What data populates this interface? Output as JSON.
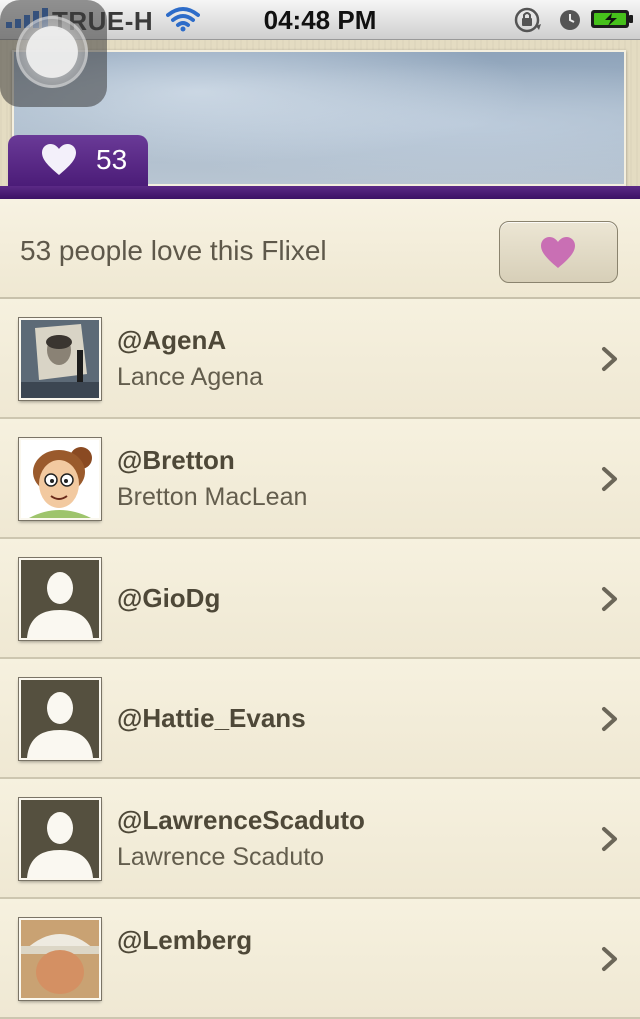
{
  "status_bar": {
    "carrier": "TRUE-H",
    "time": "04:48 PM"
  },
  "photo": {
    "like_count": "53"
  },
  "summary": {
    "text": "53 people love this Flixel"
  },
  "users": [
    {
      "handle": "@AgenA",
      "name": "Lance Agena"
    },
    {
      "handle": "@Bretton",
      "name": "Bretton MacLean"
    },
    {
      "handle": "@GioDg",
      "name": ""
    },
    {
      "handle": "@Hattie_Evans",
      "name": ""
    },
    {
      "handle": "@LawrenceScaduto",
      "name": "Lawrence Scaduto"
    },
    {
      "handle": "@Lemberg",
      "name": ""
    }
  ],
  "colors": {
    "accent_purple": "#4b1c78",
    "heart_pink": "#c96fb4",
    "background": "#f2ecd8"
  },
  "icons": {
    "heart": "heart-icon",
    "chevron": "chevron-right-icon",
    "placeholder_avatar": "person-silhouette-icon"
  }
}
